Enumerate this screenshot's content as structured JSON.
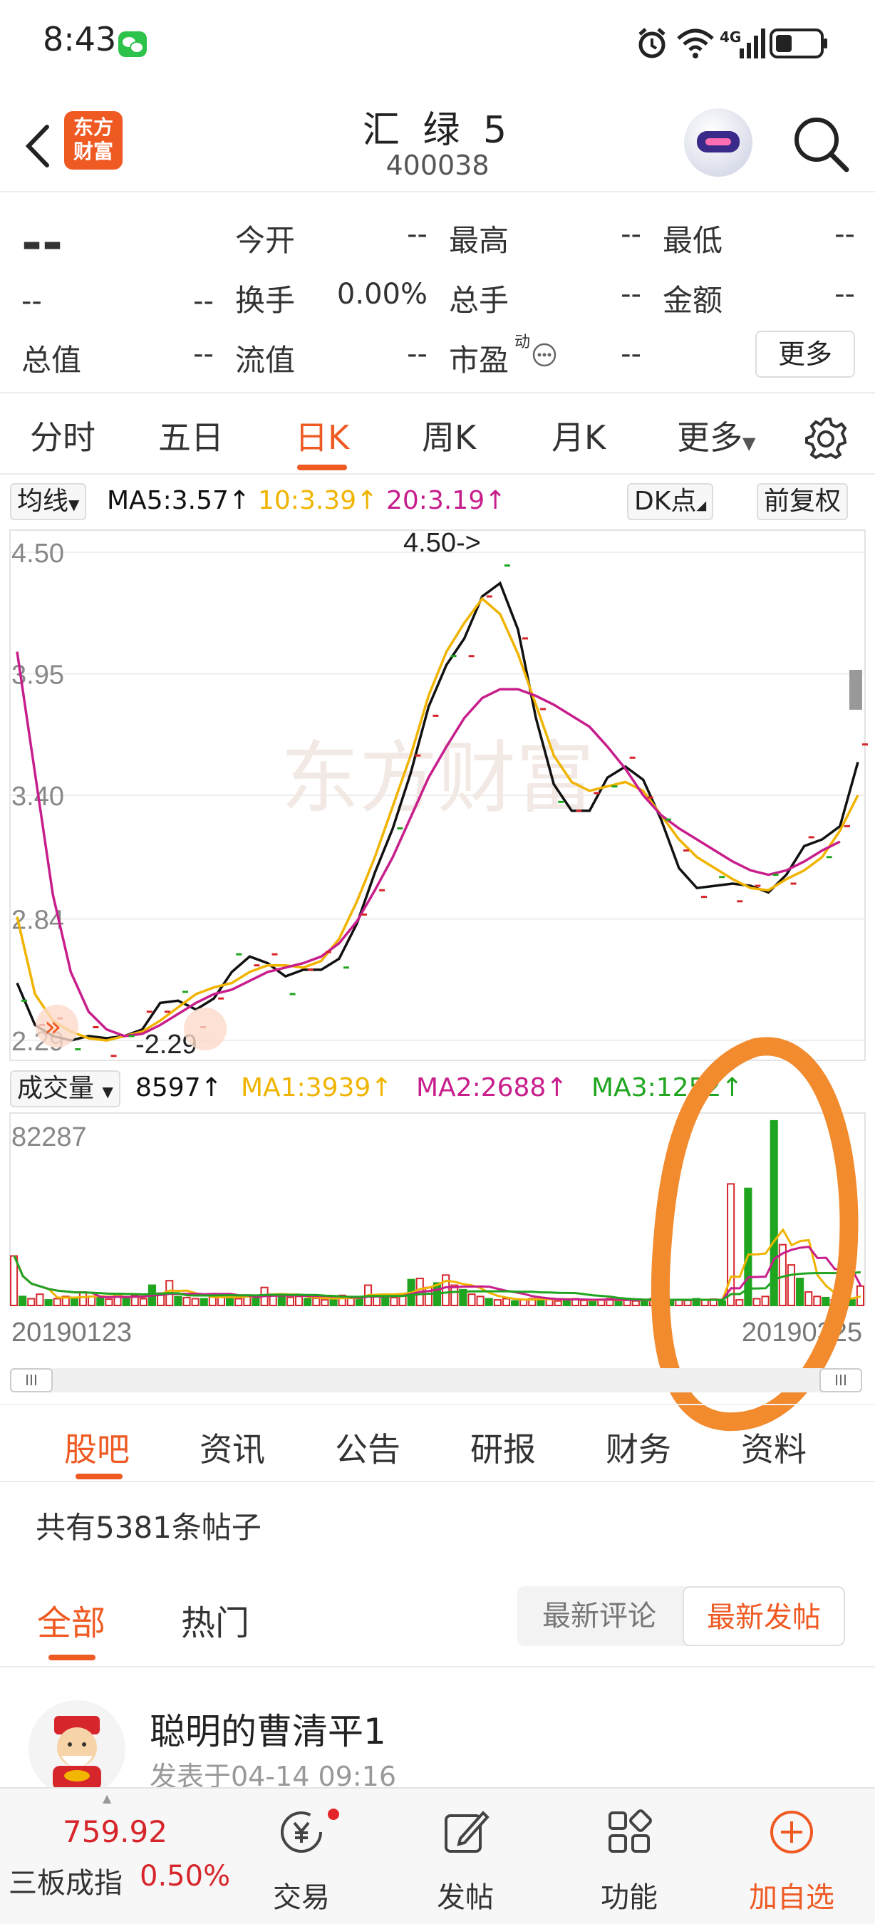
{
  "status_bar": {
    "time": "8:43",
    "network": "4G"
  },
  "header": {
    "logo_line1": "东方",
    "logo_line2": "财富",
    "stock_name": "汇 绿 5",
    "stock_code": "400038"
  },
  "quote": {
    "price": "--",
    "change": "--",
    "change_pct": "--",
    "open_label": "今开",
    "open": "--",
    "high_label": "最高",
    "high": "--",
    "low_label": "最低",
    "low": "--",
    "turnover_label": "换手",
    "turnover": "0.00%",
    "volume_label": "总手",
    "volume": "--",
    "amount_label": "金额",
    "amount": "--",
    "mktcap_label": "总值",
    "mktcap": "--",
    "float_label": "流值",
    "float": "--",
    "pe_label": "市盈",
    "pe_sup": "动",
    "pe": "--",
    "more_label": "更多"
  },
  "period_tabs": [
    "分时",
    "五日",
    "日K",
    "周K",
    "月K",
    "更多"
  ],
  "active_period": "日K",
  "ma_legend": {
    "selector": "均线",
    "ma5": "MA5:3.57↑",
    "ma10": "10:3.39↑",
    "ma20": "20:3.19↑",
    "dk": "DK点",
    "adjust": "前复权"
  },
  "chart_data": [
    {
      "type": "line",
      "title": "日K",
      "y_ticks": [
        "4.50",
        "3.95",
        "3.40",
        "2.84",
        "2.29"
      ],
      "ylim": [
        2.2,
        4.6
      ],
      "annotations": [
        "4.50->",
        "-2.29"
      ],
      "watermark": "东方财富",
      "x": [
        1,
        2,
        3,
        4,
        5,
        6,
        7,
        8,
        9,
        10,
        11,
        12,
        13,
        14,
        15,
        16,
        17,
        18,
        19,
        20,
        21,
        22,
        23,
        24,
        25,
        26,
        27,
        28,
        29,
        30,
        31,
        32,
        33,
        34,
        35,
        36,
        37,
        38,
        39,
        40,
        41,
        42,
        43,
        44,
        45,
        46,
        47,
        48,
        49,
        50
      ],
      "series": [
        {
          "name": "MA5",
          "color": "#111111",
          "values": [
            2.55,
            2.36,
            2.31,
            2.29,
            2.31,
            2.3,
            2.31,
            2.34,
            2.46,
            2.47,
            2.43,
            2.48,
            2.6,
            2.67,
            2.64,
            2.58,
            2.61,
            2.61,
            2.66,
            2.82,
            3.05,
            3.25,
            3.5,
            3.8,
            3.99,
            4.11,
            4.3,
            4.36,
            4.15,
            3.75,
            3.45,
            3.33,
            3.33,
            3.48,
            3.53,
            3.47,
            3.29,
            3.07,
            2.98,
            2.99,
            3.0,
            2.99,
            2.96,
            3.04,
            3.17,
            3.2,
            3.26,
            3.55
          ]
        },
        {
          "name": "MA10",
          "color": "#f0b400",
          "values": [
            2.85,
            2.5,
            2.38,
            2.33,
            2.3,
            2.29,
            2.31,
            2.33,
            2.38,
            2.44,
            2.5,
            2.53,
            2.55,
            2.6,
            2.63,
            2.63,
            2.62,
            2.65,
            2.75,
            2.92,
            3.12,
            3.35,
            3.58,
            3.85,
            4.05,
            4.18,
            4.29,
            4.22,
            4.04,
            3.81,
            3.58,
            3.46,
            3.42,
            3.44,
            3.46,
            3.42,
            3.31,
            3.2,
            3.12,
            3.07,
            3.02,
            2.98,
            2.97,
            3.02,
            3.06,
            3.12,
            3.24,
            3.4
          ]
        },
        {
          "name": "MA20",
          "color": "#c81e8c",
          "values": [
            4.05,
            3.5,
            2.95,
            2.6,
            2.42,
            2.34,
            2.31,
            2.32,
            2.36,
            2.41,
            2.46,
            2.5,
            2.52,
            2.56,
            2.6,
            2.62,
            2.64,
            2.67,
            2.73,
            2.83,
            2.97,
            3.12,
            3.3,
            3.48,
            3.62,
            3.75,
            3.84,
            3.88,
            3.88,
            3.85,
            3.81,
            3.76,
            3.71,
            3.62,
            3.52,
            3.4,
            3.31,
            3.25,
            3.2,
            3.15,
            3.1,
            3.06,
            3.04,
            3.06,
            3.1,
            3.15,
            3.19
          ]
        }
      ]
    },
    {
      "type": "bar",
      "title": "成交量",
      "y_ticks": [
        "82287"
      ],
      "ylim": [
        0,
        82287
      ],
      "x_start": "20190123",
      "x_end": "20190325",
      "legend": {
        "label": "成交量",
        "vol": "8597↑",
        "ma1": "MA1:3939↑",
        "ma2": "MA2:2688↑",
        "ma3": "MA3:1252↑"
      },
      "values": [
        22000,
        4000,
        3000,
        5000,
        2500,
        3000,
        4000,
        3000,
        6000,
        4000,
        3500,
        2800,
        5000,
        3500,
        4500,
        3000,
        9000,
        5500,
        11000,
        4000,
        3500,
        3000,
        3000,
        5000,
        4000,
        3500,
        3000,
        4500,
        4000,
        8000,
        5000,
        3800,
        3600,
        4000,
        3000,
        3200,
        2500,
        3000,
        4500,
        3500,
        3000,
        9000,
        4000,
        5000,
        3500,
        4500,
        11500,
        12000,
        8000,
        10000,
        13500,
        9000,
        7000,
        5000,
        4000,
        3000,
        2500,
        3000,
        2000,
        2500,
        3000,
        3500,
        2800,
        2000,
        2500,
        3000,
        2200,
        2000,
        2500,
        3000,
        2000,
        2600,
        2000,
        2500,
        3000,
        2800,
        2000,
        2600,
        2200,
        3000,
        2500,
        2800,
        2000,
        54000,
        2500,
        52000,
        3000,
        4000,
        82000,
        27000,
        18000,
        12000,
        6000,
        4000,
        3500,
        2500,
        3000,
        2500,
        8597
      ],
      "colors": [
        "#d6262b",
        "#1fa51f"
      ],
      "ma_series": [
        {
          "name": "MA1",
          "color": "#f0b400"
        },
        {
          "name": "MA2",
          "color": "#c81e8c"
        },
        {
          "name": "MA3",
          "color": "#1fa51f"
        }
      ]
    }
  ],
  "section_tabs": [
    "股吧",
    "资讯",
    "公告",
    "研报",
    "财务",
    "资料"
  ],
  "active_section": "股吧",
  "posts": {
    "count_text": "共有5381条帖子",
    "filter_tabs": [
      "全部",
      "热门"
    ],
    "sort_latest_comment": "最新评论",
    "sort_latest_post": "最新发帖",
    "items": [
      {
        "user": "聪明的曹清平1",
        "time": "发表于04-14 09:16"
      }
    ]
  },
  "bottom_bar": {
    "index_value": "759.92",
    "index_name": "三板成指",
    "index_change": "0.50%",
    "items": [
      "交易",
      "发帖",
      "功能",
      "加自选"
    ]
  }
}
